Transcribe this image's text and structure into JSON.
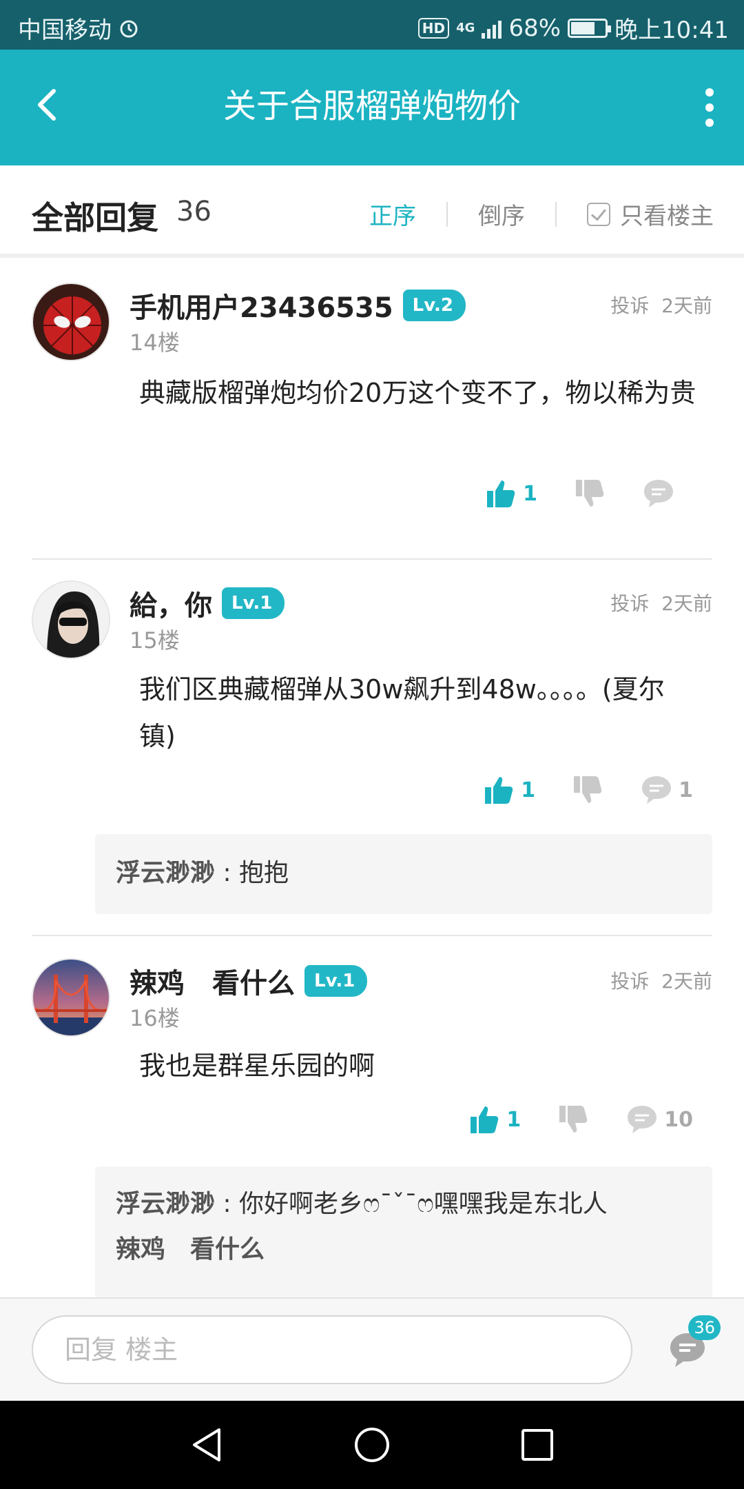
{
  "status_bar": {
    "carrier": "中国移动",
    "hd": "HD",
    "network": "4G",
    "battery": "68%",
    "time": "晚上10:41"
  },
  "title_bar": {
    "title": "关于合服榴弹炮物价"
  },
  "reply_header": {
    "label": "全部回复",
    "count": "36",
    "sort_asc": "正序",
    "sort_desc": "倒序",
    "only_owner": "只看楼主"
  },
  "posts": [
    {
      "username": "手机用户23436535",
      "level": "Lv.2",
      "report": "投诉",
      "time": "2天前",
      "floor": "14楼",
      "content": "典藏版榴弹炮均价20万这个变不了，物以稀为贵",
      "likes": "1",
      "replies": ""
    },
    {
      "username": "給，你",
      "level": "Lv.1",
      "report": "投诉",
      "time": "2天前",
      "floor": "15楼",
      "content": "我们区典藏榴弹从30w飙升到48w。。。。(夏尔镇)",
      "likes": "1",
      "replies": "1",
      "sub_replies": [
        {
          "author": "浮云渺渺",
          "sep": " : ",
          "text": "抱抱"
        }
      ]
    },
    {
      "username": "辣鸡　看什么",
      "level": "Lv.1",
      "report": "投诉",
      "time": "2天前",
      "floor": "16楼",
      "content": "我也是群星乐园的啊",
      "likes": "1",
      "replies": "10",
      "sub_replies": [
        {
          "author": "浮云渺渺",
          "sep": " : ",
          "text": "你好啊老乡ෆ¯ˇ¯ෆ嘿嘿我是东北人"
        },
        {
          "author": "辣鸡　看什么",
          "sep": "",
          "text": ""
        }
      ]
    }
  ],
  "input_bar": {
    "placeholder": "回复  楼主",
    "comment_count": "36"
  },
  "colors": {
    "status_bar": "#15606b",
    "accent": "#1bb3c2",
    "divider": "#e6e6e6"
  },
  "icons": [
    "back-icon",
    "more-icon",
    "checkbox-icon",
    "thumb-up-icon",
    "thumb-down-icon",
    "comment-icon",
    "nav-back-icon",
    "nav-home-icon",
    "nav-recent-icon"
  ]
}
